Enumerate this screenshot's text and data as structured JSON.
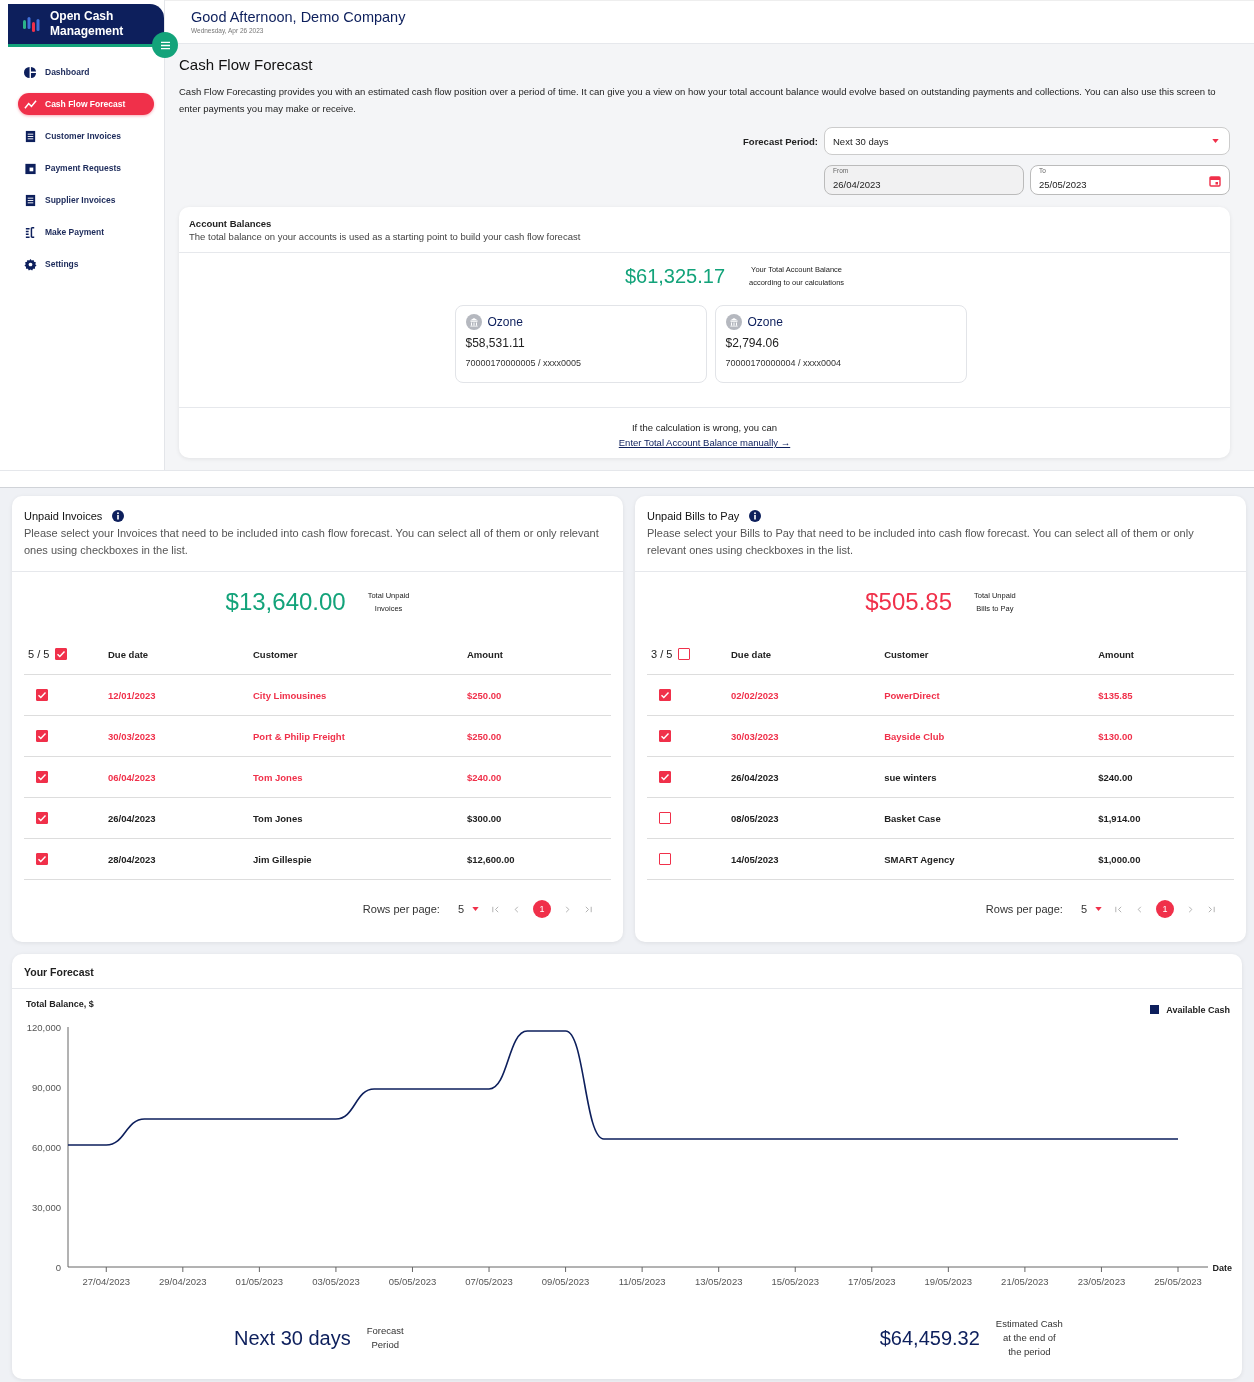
{
  "app": {
    "name": "Open Cash Management"
  },
  "sidebar": {
    "items": [
      {
        "label": "Dashboard",
        "selected": false
      },
      {
        "label": "Cash Flow Forecast",
        "selected": true
      },
      {
        "label": "Customer Invoices",
        "selected": false
      },
      {
        "label": "Payment Requests",
        "selected": false
      },
      {
        "label": "Supplier Invoices",
        "selected": false
      },
      {
        "label": "Make Payment",
        "selected": false
      },
      {
        "label": "Settings",
        "selected": false
      }
    ]
  },
  "header": {
    "greeting": "Good Afternoon, Demo Company",
    "date": "Wednesday, Apr 26 2023"
  },
  "page": {
    "title": "Cash Flow Forecast",
    "description": "Cash Flow Forecasting provides you with an estimated cash flow position over a period of time. It can give you a view on how your total account balance would evolve based on outstanding payments and collections. You can also use this screen to enter payments you may make or receive."
  },
  "forecast_period": {
    "label": "Forecast Period:",
    "value": "Next 30 days",
    "from_label": "From",
    "from": "26/04/2023",
    "to_label": "To",
    "to": "25/05/2023"
  },
  "account_balances": {
    "title": "Account Balances",
    "subtitle": "The total balance on your accounts is used as a starting point to build your cash flow forecast",
    "total": "$61,325.17",
    "total_caption": [
      "Your Total Account Balance",
      "according to our calculations"
    ],
    "accounts": [
      {
        "bank": "Ozone",
        "balance": "$58,531.11",
        "number": "70000170000005 / xxxx0005"
      },
      {
        "bank": "Ozone",
        "balance": "$2,794.06",
        "number": "70000170000004 / xxxx0004"
      }
    ],
    "hint": "If the calculation is wrong, you can",
    "link": "Enter Total Account Balance manually →"
  },
  "lists": [
    {
      "kind": "receivable",
      "title": "Unpaid Invoices",
      "description": "Please select your Invoices that need to be included into cash flow forecast. You can select all of them or only relevant ones using checkboxes in the list.",
      "total": "$13,640.00",
      "total_caption": [
        "Total Unpaid",
        "Invoices"
      ],
      "count": "5 / 5",
      "all_checked": true,
      "columns": [
        "Due date",
        "Customer",
        "Amount"
      ],
      "rows": [
        {
          "due": "12/01/2023",
          "customer": "City Limousines",
          "amount": "$250.00",
          "checked": true,
          "overdue": true
        },
        {
          "due": "30/03/2023",
          "customer": "Port & Philip Freight",
          "amount": "$250.00",
          "checked": true,
          "overdue": true
        },
        {
          "due": "06/04/2023",
          "customer": "Tom Jones",
          "amount": "$240.00",
          "checked": true,
          "overdue": true
        },
        {
          "due": "26/04/2023",
          "customer": "Tom Jones",
          "amount": "$300.00",
          "checked": true,
          "overdue": false
        },
        {
          "due": "28/04/2023",
          "customer": "Jim Gillespie",
          "amount": "$12,600.00",
          "checked": true,
          "overdue": false
        }
      ],
      "rows_per_page_label": "Rows per page:",
      "rows_per_page": "5",
      "page": "1"
    },
    {
      "kind": "payable",
      "title": "Unpaid Bills to Pay",
      "description": "Please select your Bills to Pay that need to be included into cash flow forecast. You can select all of them or only relevant ones using checkboxes in the list.",
      "total": "$505.85",
      "total_caption": [
        "Total Unpaid",
        "Bills to Pay"
      ],
      "count": "3 / 5",
      "all_checked": false,
      "columns": [
        "Due date",
        "Customer",
        "Amount"
      ],
      "rows": [
        {
          "due": "02/02/2023",
          "customer": "PowerDirect",
          "amount": "$135.85",
          "checked": true,
          "overdue": true
        },
        {
          "due": "30/03/2023",
          "customer": "Bayside Club",
          "amount": "$130.00",
          "checked": true,
          "overdue": true
        },
        {
          "due": "26/04/2023",
          "customer": "sue winters",
          "amount": "$240.00",
          "checked": true,
          "overdue": false
        },
        {
          "due": "08/05/2023",
          "customer": "Basket Case",
          "amount": "$1,914.00",
          "checked": false,
          "overdue": false
        },
        {
          "due": "14/05/2023",
          "customer": "SMART Agency",
          "amount": "$1,000.00",
          "checked": false,
          "overdue": false
        }
      ],
      "rows_per_page_label": "Rows per page:",
      "rows_per_page": "5",
      "page": "1"
    }
  ],
  "forecast": {
    "title": "Your Forecast",
    "chart_data": {
      "type": "line",
      "xlabel": "Date",
      "ylabel": "Total Balance, $",
      "categories": [
        null,
        "27/04/2023",
        null,
        "29/04/2023",
        null,
        "01/05/2023",
        null,
        "03/05/2023",
        null,
        "05/05/2023",
        null,
        "07/05/2023",
        null,
        "09/05/2023",
        null,
        "11/05/2023",
        null,
        "13/05/2023",
        null,
        "15/05/2023",
        null,
        "17/05/2023",
        null,
        "19/05/2023",
        null,
        "21/05/2023",
        null,
        "23/05/2023",
        null,
        "25/05/2023"
      ],
      "series": [
        {
          "name": "Available Cash",
          "color": "#0d1f5c",
          "values": [
            61000,
            61000,
            74000,
            74000,
            74000,
            74000,
            74000,
            74000,
            89000,
            89000,
            89000,
            89000,
            118000,
            118000,
            64000,
            64000,
            64000,
            64000,
            64000,
            64000,
            64000,
            64000,
            64000,
            64000,
            64000,
            64000,
            64000,
            64000,
            64000,
            64000
          ]
        }
      ],
      "ylim": [
        0,
        120000
      ],
      "yticks": [
        {
          "value": 0,
          "label": "0"
        },
        {
          "value": 30000,
          "label": "30,000"
        },
        {
          "value": 60000,
          "label": "60,000"
        },
        {
          "value": 90000,
          "label": "90,000"
        },
        {
          "value": 120000,
          "label": "120,000"
        }
      ]
    },
    "period": "Next 30 days",
    "period_caption": [
      "Forecast",
      "Period"
    ],
    "end_cash": "$64,459.32",
    "end_caption": [
      "Estimated Cash",
      "at the end of",
      "the period"
    ]
  }
}
